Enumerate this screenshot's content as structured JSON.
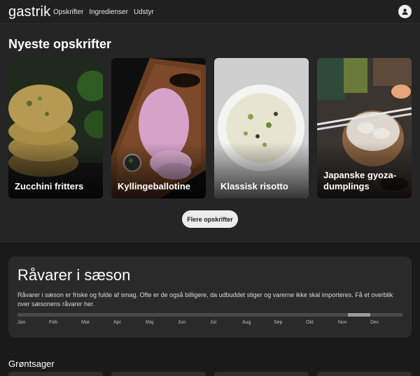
{
  "header": {
    "logo": "gastrik",
    "nav": [
      "Opskrifter",
      "Ingredienser",
      "Udstyr"
    ],
    "account_icon": "user-icon"
  },
  "recent": {
    "heading": "Nyeste opskrifter",
    "cards": [
      {
        "title": "Zucchini fritters"
      },
      {
        "title": "Kyllingeballotine"
      },
      {
        "title": "Klassisk risotto"
      },
      {
        "title": "Japanske gyoza-dumplings"
      }
    ],
    "more_button": "Flere opskrifter"
  },
  "season": {
    "heading": "Råvarer i sæson",
    "description": "Råvarer i sæson er friske og fulde af smag. Ofte er de også billigere, da udbuddet stiger og varerne ikke skal importeres. Få et overblik over sæsonens råvarer her.",
    "months": [
      "Jan",
      "Feb",
      "Mar",
      "Apr",
      "Maj",
      "Jun",
      "Jul",
      "Aug",
      "Sep",
      "Okt",
      "Nov",
      "Dec"
    ],
    "current_month": "Nov"
  },
  "vegetables": {
    "heading": "Grøntsager"
  },
  "colors": {
    "background": "#1a1a1a",
    "panel": "#2a2a2a",
    "button": "#ececec"
  }
}
